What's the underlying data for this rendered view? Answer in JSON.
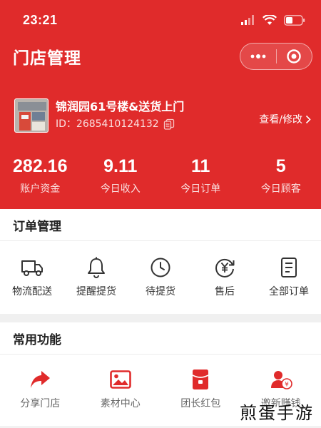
{
  "status_bar": {
    "time": "23:21"
  },
  "header": {
    "title": "门店管理",
    "accent_color": "#e02b2b"
  },
  "store": {
    "name": "锦润园61号楼&送货上门",
    "id_text": "ID：2685410124132",
    "view_edit_label": "查看/修改"
  },
  "stats": [
    {
      "value": "282.16",
      "label": "账户资金"
    },
    {
      "value": "9.11",
      "label": "今日收入"
    },
    {
      "value": "11",
      "label": "今日订单"
    },
    {
      "value": "5",
      "label": "今日顾客"
    }
  ],
  "orders": {
    "title": "订单管理",
    "items": [
      {
        "label": "物流配送",
        "icon": "truck-icon"
      },
      {
        "label": "提醒提货",
        "icon": "bell-icon"
      },
      {
        "label": "待提货",
        "icon": "clock-icon"
      },
      {
        "label": "售后",
        "icon": "refund-icon"
      },
      {
        "label": "全部订单",
        "icon": "document-icon"
      }
    ]
  },
  "tools": {
    "title": "常用功能",
    "items": [
      {
        "label": "分享门店",
        "icon": "share-icon"
      },
      {
        "label": "素材中心",
        "icon": "image-icon"
      },
      {
        "label": "团长红包",
        "icon": "red-envelope-icon"
      },
      {
        "label": "邀新赚钱",
        "icon": "invite-money-icon"
      }
    ]
  },
  "watermark": "煎蛋手游"
}
